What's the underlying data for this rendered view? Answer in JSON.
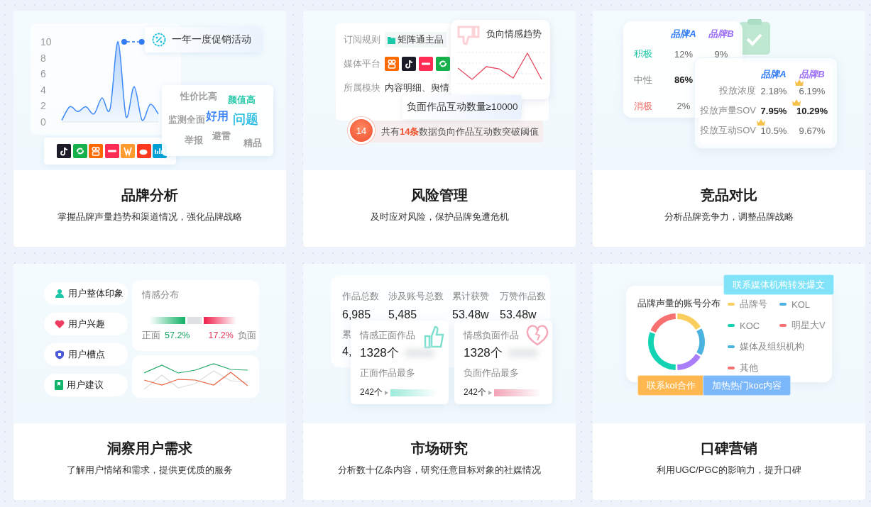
{
  "cards": [
    {
      "kind": "brand",
      "title": "品牌分析",
      "subtitle": "掌握品牌声量趋势和渠道情况，强化品牌战略",
      "promo": "一年一度促销活动",
      "chart_data": {
        "type": "area",
        "values": [
          0.2,
          1.9,
          1.3,
          1.9,
          1.0,
          3.0,
          1.6,
          10,
          0.6,
          4.4,
          0.2,
          2.2,
          1.0
        ],
        "ylim": [
          0,
          10
        ],
        "yticks": [
          0,
          2,
          4,
          6,
          8,
          10
        ]
      },
      "words": [
        {
          "text": "性价比高",
          "color": "#9a9a9a"
        },
        {
          "text": "颜值高",
          "color": "#1fc6a6"
        },
        {
          "text": "监测全面",
          "color": "#9a9a9a"
        },
        {
          "text": "好用",
          "color": "#2f7cf6"
        },
        {
          "text": "问题",
          "color": "#1eb9e0"
        },
        {
          "text": "举报",
          "color": "#9a9a9a"
        },
        {
          "text": "避雷",
          "color": "#9a9a9a"
        },
        {
          "text": "精品",
          "color": "#9a9a9a"
        }
      ]
    },
    {
      "kind": "risk",
      "title": "风险管理",
      "subtitle": "及时应对风险，保护品牌免遭危机",
      "rule_label": "订阅规则",
      "rule_value": "矩阵通主品",
      "platform_label": "媒体平台",
      "module_label": "所属模块",
      "module_value": "内容明细、舆情",
      "trend_title": "负向情感趋势",
      "threshold": "负面作品互动数量≥10000",
      "alert_count": "14",
      "alert_text": "共有**14条**数据负向作品互动数突破阈值"
    },
    {
      "kind": "compare",
      "title": "竞品对比",
      "subtitle": "分析品牌竞争力，调整品牌战略",
      "sentiment_table": {
        "columns": [
          {
            "label": "品牌A",
            "color": "#2f7cf6"
          },
          {
            "label": "品牌B",
            "color": "#9b6cf7"
          }
        ],
        "rows": [
          {
            "label": "积极",
            "color": "#1fc6a6",
            "cells": [
              {
                "value": "12%",
                "emphasis": false
              },
              {
                "value": "9%",
                "emphasis": false
              }
            ]
          },
          {
            "label": "中性",
            "color": "#8c8c8c",
            "cells": [
              {
                "value": "86%",
                "emphasis": true
              }
            ]
          },
          {
            "label": "消极",
            "color": "#f0706a",
            "cells": [
              {
                "value": "2%",
                "emphasis": false
              }
            ]
          }
        ]
      },
      "ad_table": {
        "columns": [
          {
            "label": "品牌A",
            "color": "#2f7cf6"
          },
          {
            "label": "品牌B",
            "color": "#9b6cf7"
          }
        ],
        "rows": [
          {
            "label": "投放浓度",
            "cells": [
              {
                "value": "2.18%",
                "emphasis": false,
                "crown": false
              },
              {
                "value": "6.19%",
                "emphasis": false,
                "crown": true
              }
            ]
          },
          {
            "label": "投放声量SOV",
            "cells": [
              {
                "value": "7.95%",
                "emphasis": true,
                "crown": false
              },
              {
                "value": "10.29%",
                "emphasis": true,
                "crown": true
              }
            ]
          },
          {
            "label": "投放互动SOV",
            "cells": [
              {
                "value": "10.5%",
                "emphasis": false,
                "crown": true
              },
              {
                "value": "9.67%",
                "emphasis": false,
                "crown": false
              }
            ]
          }
        ]
      }
    },
    {
      "kind": "insight",
      "title": "洞察用户需求",
      "subtitle": "了解用户情绪和需求，提供更优质的服务",
      "aspects": [
        {
          "kind": "impression",
          "label": "用户整体印象"
        },
        {
          "kind": "interest",
          "label": "用户兴趣"
        },
        {
          "kind": "complaint",
          "label": "用户槽点"
        },
        {
          "kind": "suggestion",
          "label": "用户建议"
        }
      ],
      "sentiment": {
        "title": "情感分布",
        "positive": {
          "label": "正面",
          "reading": "57.2%"
        },
        "negative": {
          "label": "负面",
          "reading": "17.2%"
        }
      }
    },
    {
      "kind": "market",
      "title": "市场研究",
      "subtitle": "分析数十亿条内容，研究任意目标对象的社媒情况",
      "stats": [
        {
          "label": "作品总数",
          "value": "6,985"
        },
        {
          "label": "涉及账号总数",
          "value": "5,485"
        },
        {
          "label": "累计获赞",
          "value": "53.48w"
        },
        {
          "label": "万赞作品数",
          "value": "53.48w"
        }
      ],
      "stats_partial": [
        {
          "label": "累",
          "value": "4,"
        }
      ],
      "sentiments": [
        {
          "kind": "positive",
          "title": "情感正面作品",
          "count": "1328个",
          "top_label": "正面作品最多",
          "top_count": "242个"
        },
        {
          "kind": "negative",
          "title": "情感负面作品",
          "count": "1328个",
          "top_label": "负面作品最多",
          "top_count": "242个"
        }
      ]
    },
    {
      "kind": "word_of_mouth",
      "title": "口碑营销",
      "subtitle": "利用UGC/PGC的影响力，提升口碑",
      "chart_title": "品牌声量的账号分布",
      "legend": [
        {
          "label": "品牌号",
          "color": "#f9cd5e"
        },
        {
          "label": "KOL",
          "color": "#4ab2de"
        },
        {
          "label": "KOC",
          "color": "#14d3b3"
        },
        {
          "label": "明星大V",
          "color": "#f87171"
        },
        {
          "label": "媒体及组织机构",
          "color": "#4ab2de"
        },
        {
          "label": "其他",
          "color": "#f87171"
        }
      ],
      "actions": [
        {
          "label": "联系媒体机构转发爆文",
          "color": "#80e3f8"
        },
        {
          "label": "联系kol合作",
          "color": "#ffb84f"
        },
        {
          "label": "加热热门koc内容",
          "color": "#7ab7fb"
        }
      ]
    }
  ]
}
